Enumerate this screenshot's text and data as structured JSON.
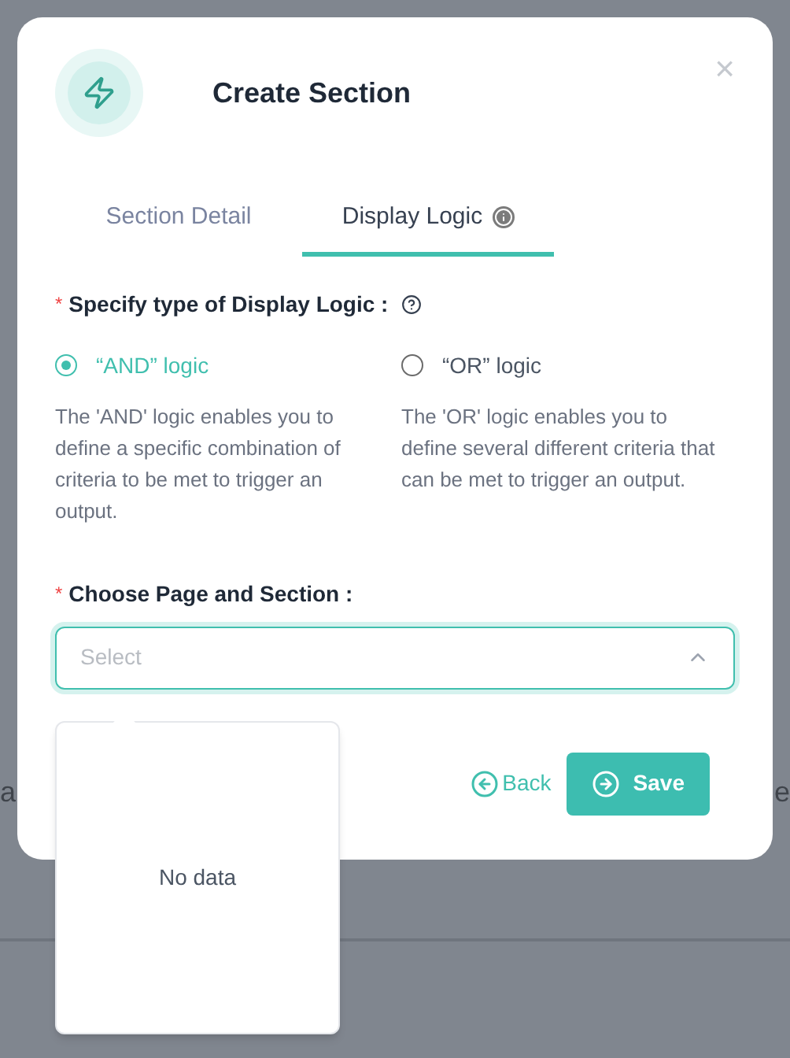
{
  "background": {
    "fragments": [
      "a",
      "e"
    ]
  },
  "dialog": {
    "title": "Create Section",
    "close": "×"
  },
  "tabs": [
    {
      "label": "Section Detail",
      "selected": false,
      "info": false
    },
    {
      "label": "Display Logic",
      "selected": true,
      "info": true
    }
  ],
  "logic_type": {
    "required_mark": "*",
    "label": "Specify type of Display Logic :",
    "options": [
      {
        "label": "“AND” logic",
        "selected": true,
        "description": "The 'AND' logic enables you to define a specific combination of criteria to be met to trigger an output."
      },
      {
        "label": "“OR” logic",
        "selected": false,
        "description": "The 'OR' logic enables you to define several different criteria that can be met to trigger an output."
      }
    ]
  },
  "page_section": {
    "required_mark": "*",
    "label": "Choose Page and Section :",
    "placeholder": "Select",
    "expanded": true,
    "empty_text": "No data"
  },
  "buttons": [
    {
      "kind": "back",
      "label": "Back"
    },
    {
      "kind": "save",
      "label": "Save"
    }
  ]
}
